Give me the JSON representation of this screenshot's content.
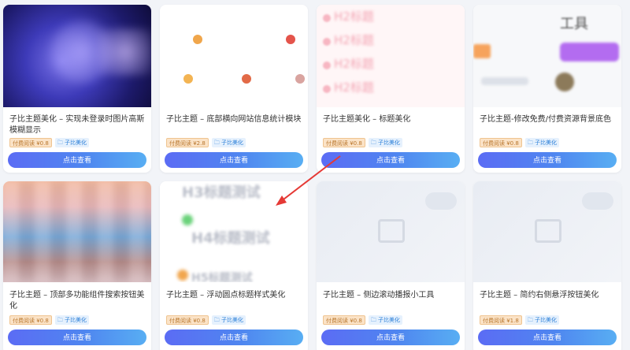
{
  "cards": [
    {
      "title": "子比主题美化 – 实现未登录时图片高斯模糊显示",
      "price": "付费阅读 ¥0.8",
      "category": "子比美化",
      "button": "点击查看"
    },
    {
      "title": "子比主题 – 底部横向网站信息统计模块",
      "price": "付费阅读 ¥2.8",
      "category": "子比美化",
      "button": "点击查看"
    },
    {
      "title": "子比主题美化 – 标题美化",
      "price": "付费阅读 ¥0.8",
      "category": "子比美化",
      "button": "点击查看"
    },
    {
      "title": "子比主题-修改免费/付费资源背景底色",
      "price": "付费阅读 ¥0.8",
      "category": "子比美化",
      "button": "点击查看"
    },
    {
      "title": "子比主题 – 顶部多功能组件搜索按钮美化",
      "price": "付费阅读 ¥0.8",
      "category": "子比美化",
      "button": "点击查看"
    },
    {
      "title": "子比主题 – 浮动圆点标题样式美化",
      "price": "付费阅读 ¥0.8",
      "category": "子比美化",
      "button": "点击查看"
    },
    {
      "title": "子比主题 – 侧边滚动播报小工具",
      "price": "付费阅读 ¥0.8",
      "category": "子比美化",
      "button": "点击查看"
    },
    {
      "title": "子比主题 – 简约右侧悬浮按钮美化",
      "price": "付费阅读 ¥1.8",
      "category": "子比美化",
      "button": "点击查看"
    }
  ],
  "thumbnails": {
    "card3_lines": [
      "H2标题",
      "H2标题",
      "H2标题",
      "H2标题"
    ],
    "card4_heading": "工具",
    "card6_lines": [
      "H3标题测试",
      "H4标题测试",
      "H5标题测试"
    ]
  },
  "colors": {
    "button_start": "#5b6cf4",
    "button_end": "#58aef3",
    "price_tag_bg": "#fbe3c7",
    "category_tag_text": "#2b7fd8",
    "annotation_arrow": "#e53935"
  },
  "icons": {
    "category": "folder-icon",
    "placeholder": "image-placeholder-icon"
  }
}
